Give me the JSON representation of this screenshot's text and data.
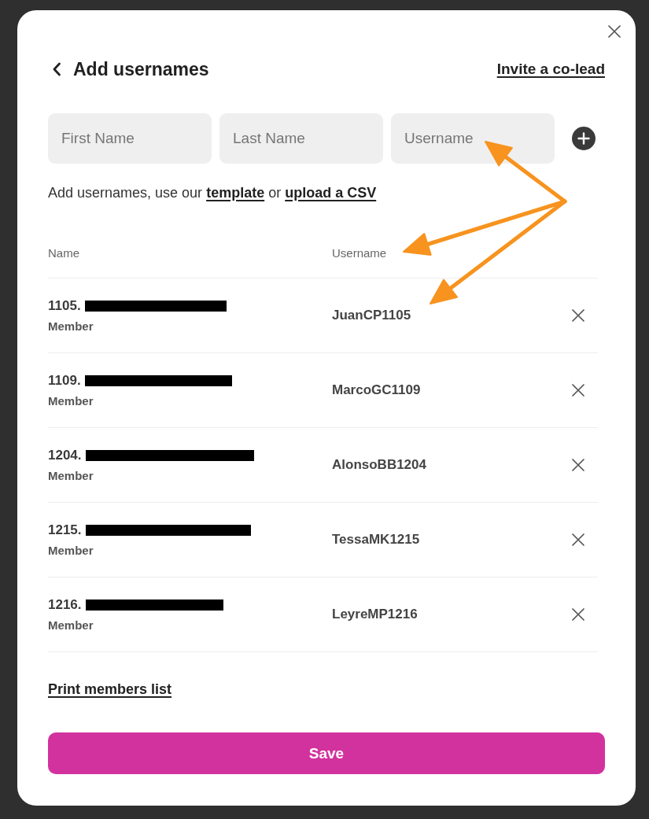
{
  "dialog": {
    "title": "Add usernames",
    "invite_link": "Invite a co-lead"
  },
  "fields": [
    {
      "placeholder": "First Name"
    },
    {
      "placeholder": "Last Name"
    },
    {
      "placeholder": "Username"
    }
  ],
  "help_text": [
    {
      "kind": "text",
      "text": "Add usernames, use our"
    },
    {
      "kind": "link",
      "text": "template"
    },
    {
      "kind": "text",
      "text": "or"
    },
    {
      "kind": "link",
      "text": "upload a CSV"
    }
  ],
  "table": {
    "columns": [
      "Name",
      "Username"
    ],
    "rows": [
      {
        "number": "1105.",
        "name_redacted": true,
        "role": "Member",
        "username": "JuanCP1105"
      },
      {
        "number": "1109.",
        "name_redacted": true,
        "role": "Member",
        "username": "MarcoGC1109"
      },
      {
        "number": "1204.",
        "name_redacted": true,
        "role": "Member",
        "username": "AlonsoBB1204"
      },
      {
        "number": "1215.",
        "name_redacted": true,
        "role": "Member",
        "username": "TessaMK1215"
      },
      {
        "number": "1216.",
        "name_redacted": true,
        "role": "Member",
        "username": "LeyreMP1216"
      }
    ]
  },
  "print_link": "Print members list",
  "save_button": "Save",
  "annotation_arrows": [
    {
      "kind": "field"
    },
    {
      "kind": "header"
    },
    {
      "kind": "cell"
    }
  ]
}
